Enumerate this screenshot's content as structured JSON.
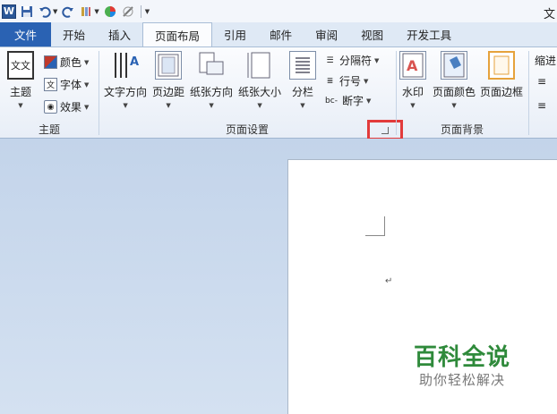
{
  "window": {
    "title_partial": "文"
  },
  "quick_access": {
    "icons": [
      "word-logo",
      "save-icon",
      "undo-icon",
      "redo-icon",
      "format-painter-icon",
      "color-wheel-icon",
      "pen-icon",
      "customize-icon"
    ],
    "word_logo_text": "W"
  },
  "tabs": [
    {
      "label": "文件"
    },
    {
      "label": "开始"
    },
    {
      "label": "插入"
    },
    {
      "label": "页面布局"
    },
    {
      "label": "引用"
    },
    {
      "label": "邮件"
    },
    {
      "label": "审阅"
    },
    {
      "label": "视图"
    },
    {
      "label": "开发工具"
    }
  ],
  "ribbon": {
    "theme": {
      "group_label": "主题",
      "themes_button": "主题",
      "colors_button": "颜色",
      "fonts_button": "字体",
      "effects_button": "效果"
    },
    "page_setup": {
      "group_label": "页面设置",
      "text_direction": "文字方向",
      "margins": "页边距",
      "orientation": "纸张方向",
      "size": "纸张大小",
      "columns": "分栏",
      "breaks": "分隔符",
      "line_numbers": "行号",
      "hyphenation": "断字",
      "hyphenation_icon": "bc-",
      "theme_icon_text": "文文",
      "font_icon_text": "文"
    },
    "page_background": {
      "group_label": "页面背景",
      "watermark": "水印",
      "page_color": "页面颜色",
      "page_borders": "页面边框"
    },
    "paragraph_partial": {
      "indent_label": "缩进"
    }
  },
  "document": {
    "paragraph_mark": "↵",
    "watermark_title": "百科全说",
    "watermark_subtitle": "助你轻松解决"
  },
  "colors": {
    "file_tab": "#2a62b3",
    "highlight": "#e23b3b",
    "watermark_green": "#2f8a3b"
  }
}
